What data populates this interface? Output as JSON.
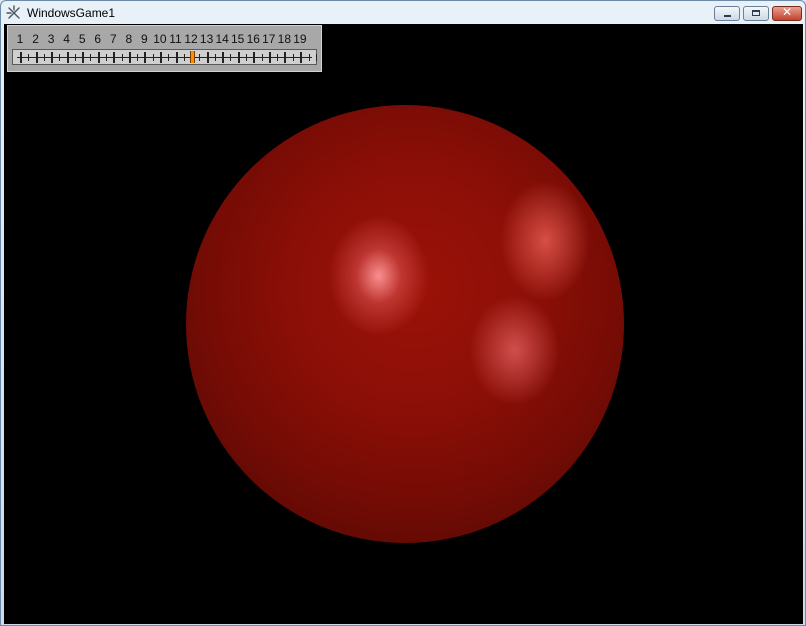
{
  "window": {
    "title": "WindowsGame1",
    "app_icon": "xna-game-icon",
    "controls": {
      "minimize": "minimize-icon",
      "maximize": "maximize-icon",
      "close": "close-icon",
      "close_glyph": "✕"
    }
  },
  "slider": {
    "labels": [
      "1",
      "2",
      "3",
      "4",
      "5",
      "6",
      "7",
      "8",
      "9",
      "10",
      "11",
      "12",
      "13",
      "14",
      "15",
      "16",
      "17",
      "18",
      "19"
    ],
    "selected_value": 12,
    "thumb_color": "#ff8c00"
  },
  "scene": {
    "object": "red-sphere",
    "background_color": "#000000",
    "sphere_color": "#8c0f07"
  }
}
